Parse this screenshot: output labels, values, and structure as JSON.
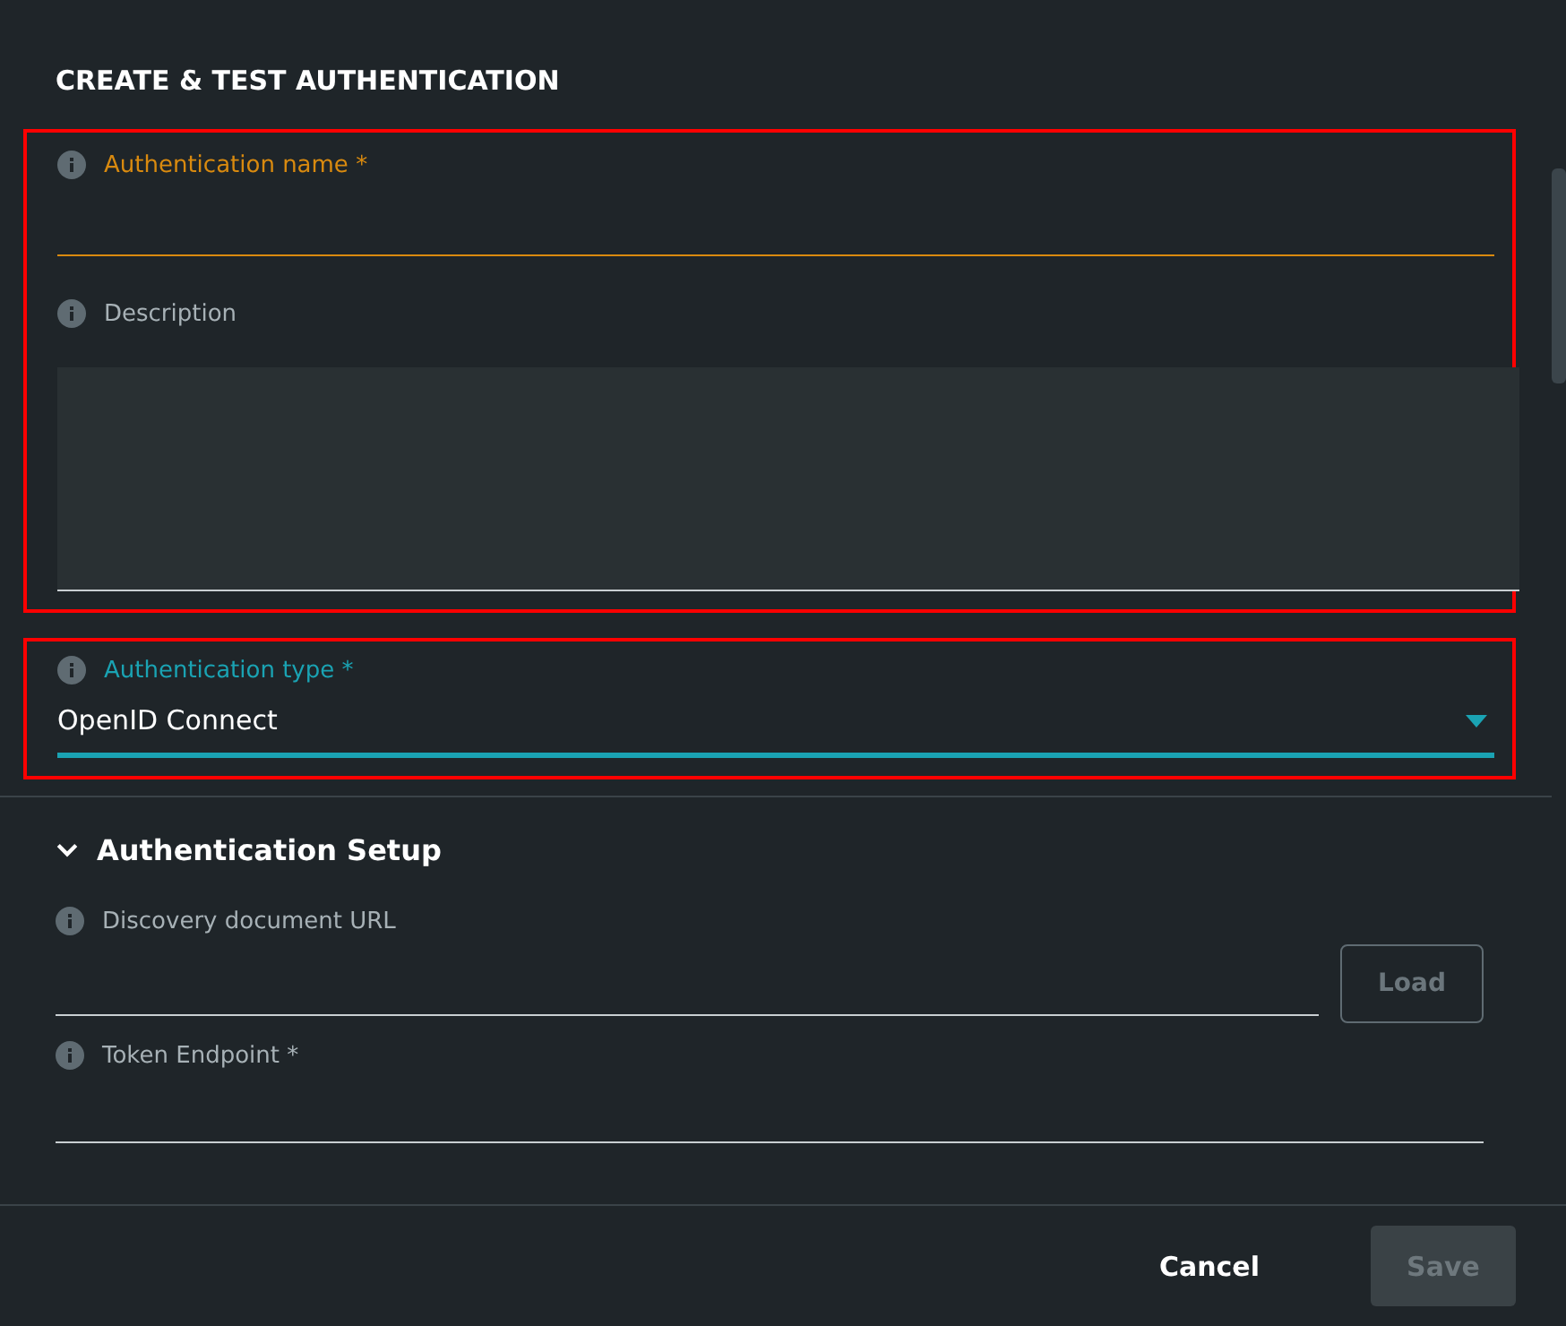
{
  "dialog": {
    "title": "CREATE & TEST AUTHENTICATION"
  },
  "groups": [
    {
      "highlighted": true,
      "fields": [
        {
          "kind": "text",
          "label": "Authentication name *",
          "invalid": true
        },
        {
          "kind": "textarea",
          "label": "Description",
          "invalid": false,
          "focused": false
        }
      ]
    },
    {
      "highlighted": true,
      "fields": [
        {
          "kind": "select",
          "label": "Authentication type *",
          "value": "OpenID Connect",
          "invalid": false,
          "focused": true
        }
      ]
    }
  ],
  "section": {
    "title": "Authentication Setup",
    "expanded": true,
    "fields": [
      {
        "kind": "text-button",
        "label": "Discovery document URL",
        "invalid": false,
        "focused": false,
        "button": "Load",
        "button_disabled": true
      },
      {
        "kind": "text",
        "label": "Token Endpoint *",
        "invalid": false,
        "focused": false
      }
    ]
  },
  "footer": {
    "cancel": "Cancel",
    "save": "Save",
    "save_disabled": true
  }
}
